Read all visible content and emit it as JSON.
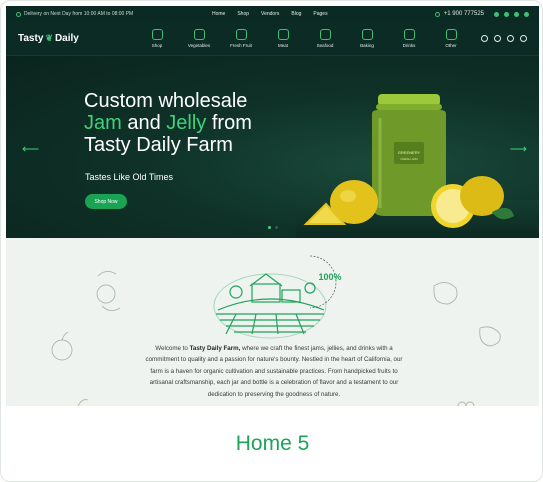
{
  "topbar": {
    "delivery_text": "Delivery on Next Day from 10:00 AM to 08:00 PM",
    "nav": [
      "Home",
      "Shop",
      "Vendors",
      "Blog",
      "Pages"
    ],
    "phone": "+1 900 777525"
  },
  "header": {
    "logo_part1": "Tasty",
    "logo_part2": "Daily",
    "categories": [
      {
        "label": "Shop",
        "icon": "store-icon"
      },
      {
        "label": "Vegetables",
        "icon": "carrot-icon"
      },
      {
        "label": "Fresh Fruit",
        "icon": "cherries-icon"
      },
      {
        "label": "Meat",
        "icon": "meat-icon"
      },
      {
        "label": "Seafood",
        "icon": "fish-icon"
      },
      {
        "label": "Baking",
        "icon": "bread-icon"
      },
      {
        "label": "Drinks",
        "icon": "bottle-icon"
      },
      {
        "label": "Other",
        "icon": "grid-icon"
      }
    ]
  },
  "hero": {
    "line1": "Custom wholesale",
    "jam": "Jam",
    "and": " and ",
    "jelly": "Jelly",
    "from": " from",
    "line3": "Tasty Daily Farm",
    "tagline": "Tastes Like Old Times",
    "button": "Shop Now",
    "jar_brand": "GREENERY",
    "jar_sub": "FRESH JAM"
  },
  "about": {
    "badge_percent": "100%",
    "intro_prefix": "Welcome to ",
    "brand": "Tasty Daily Farm,",
    "body": " where we craft the finest jams, jellies, and drinks with a commitment to quality and a passion for nature's bounty. Nestled in the heart of California, our farm is a haven for organic cultivation and sustainable practices. From handpicked fruits to artisanal craftsmanship, each jar and bottle is a celebration of flavor and a testament to our dedication to preserving the goodness of nature."
  },
  "card_title": "Home 5",
  "colors": {
    "accent": "#3fd27a",
    "brand_green": "#1aa352",
    "dark_bg": "#0c2b24"
  }
}
